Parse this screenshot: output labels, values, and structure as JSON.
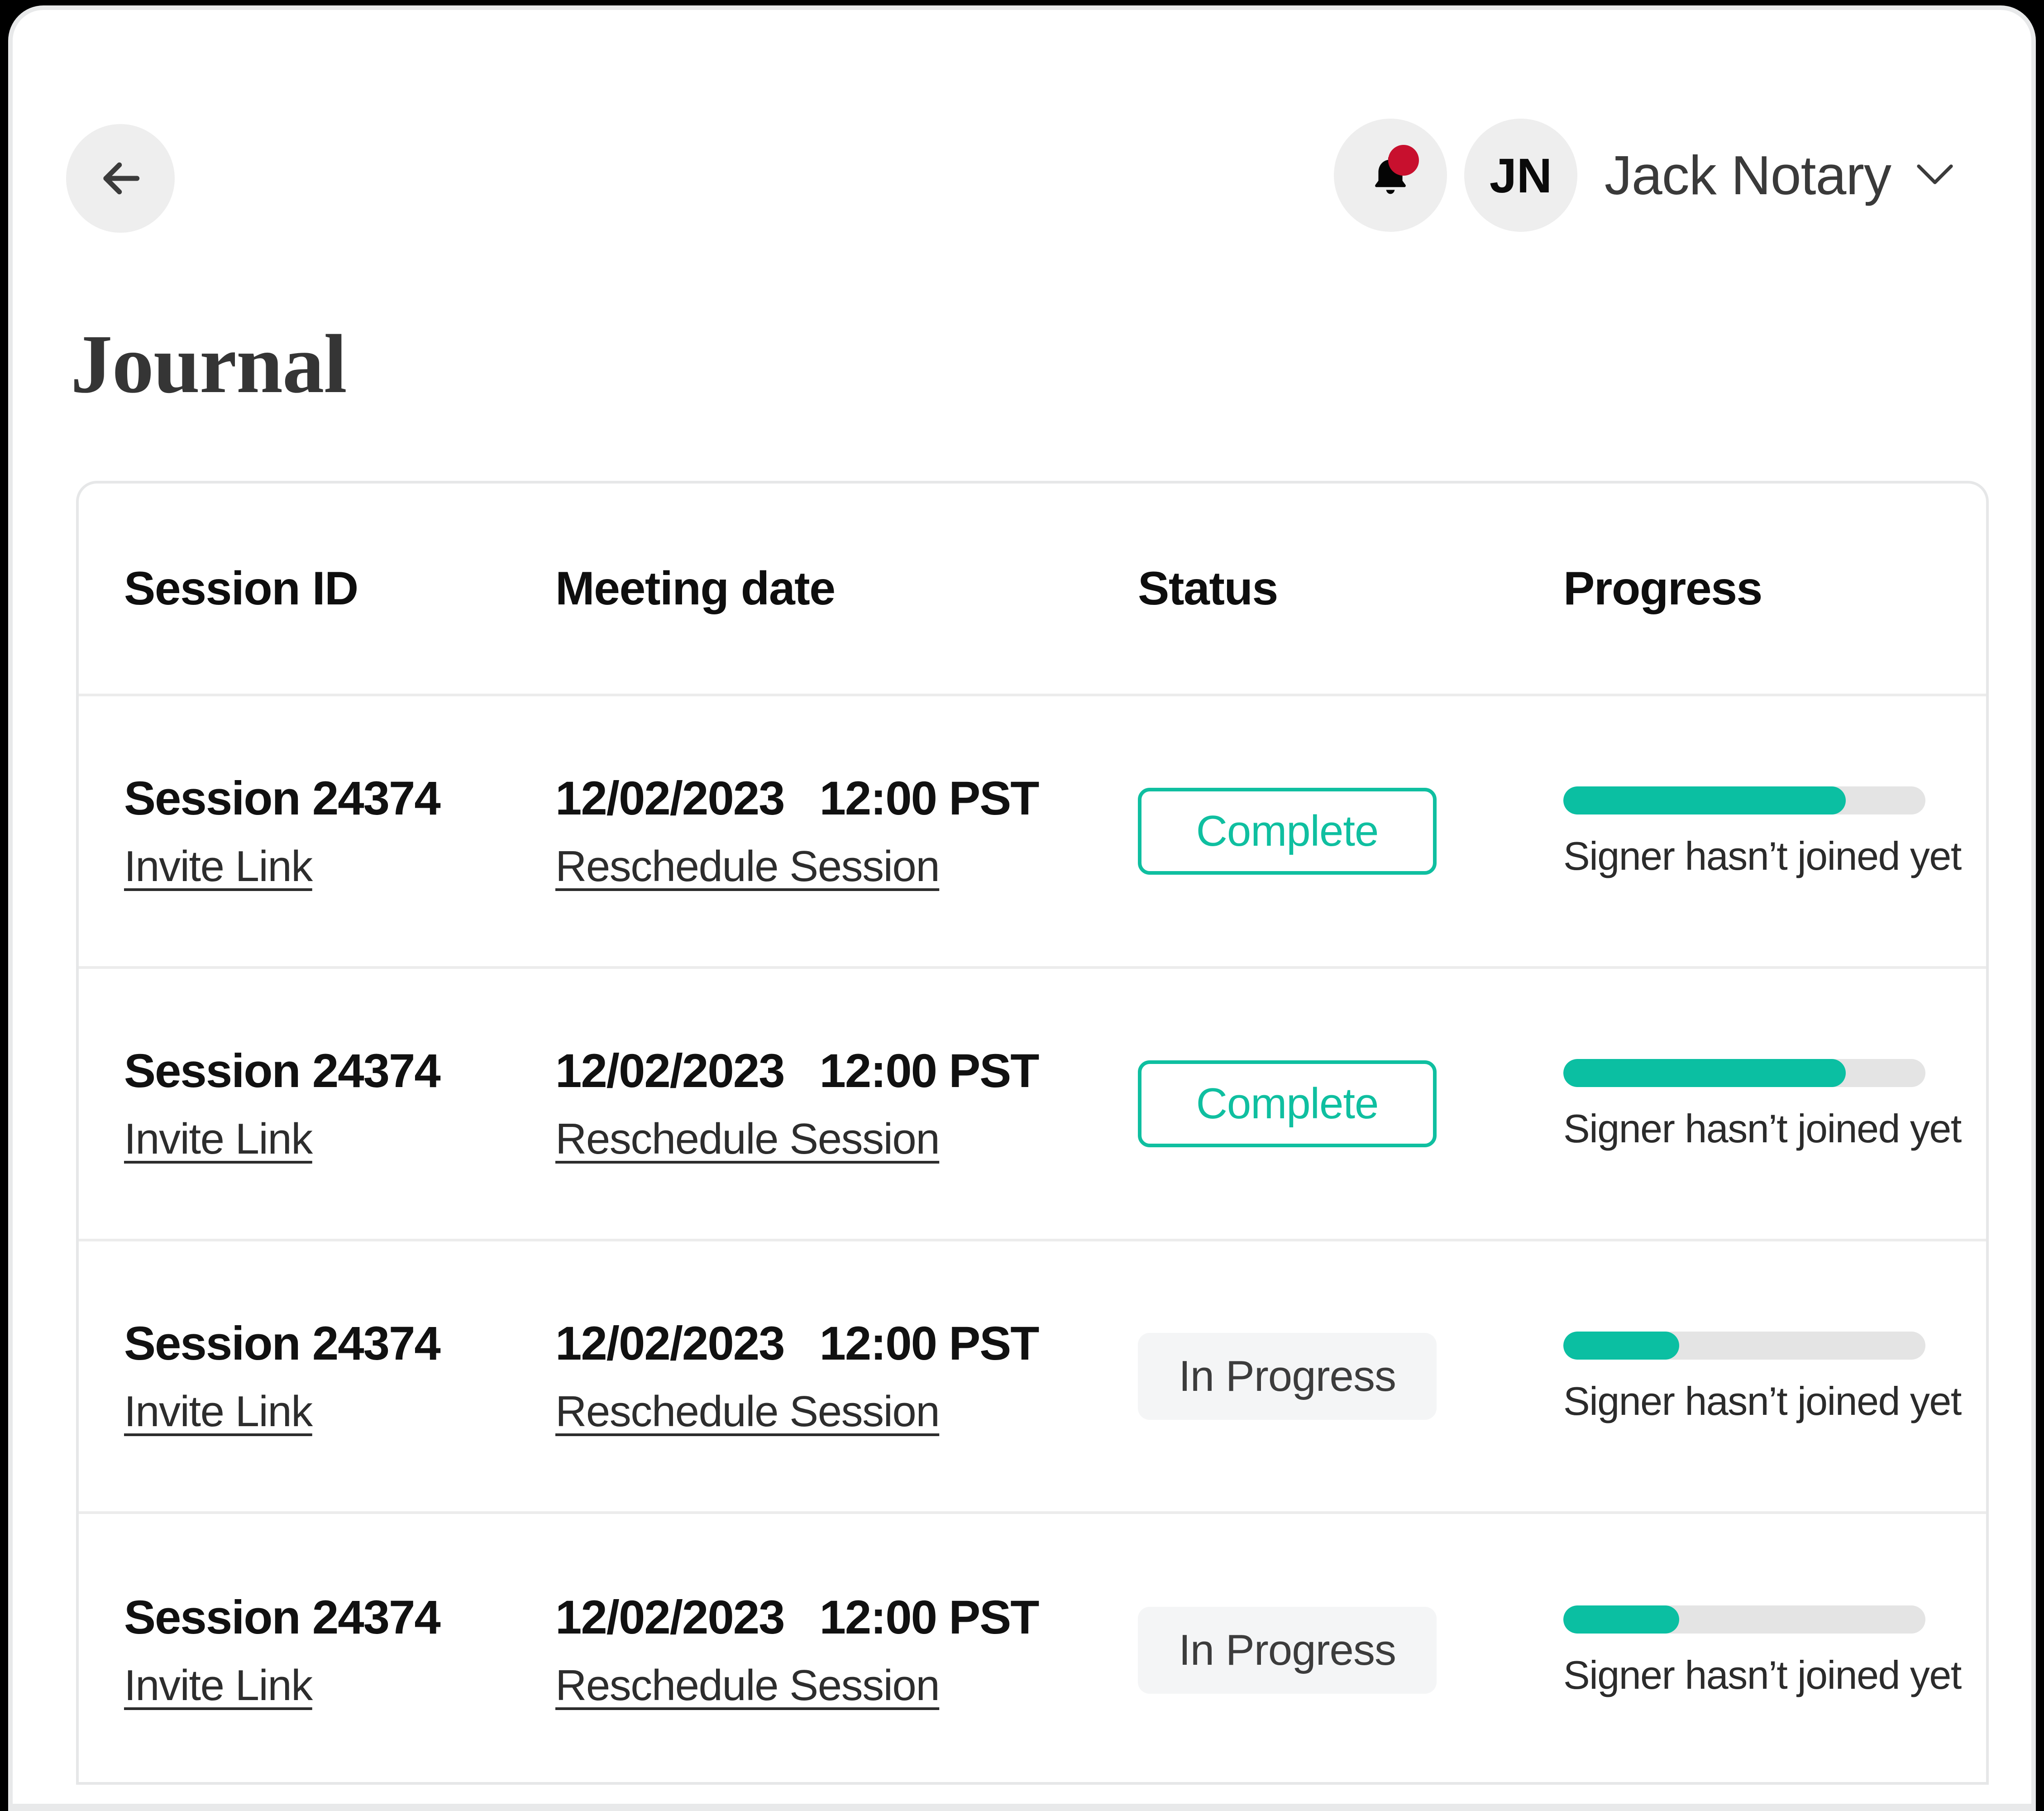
{
  "window": {
    "background_color": "#ffffff",
    "border_color": "#e8e9ea"
  },
  "topbar": {
    "back_button_label": "",
    "back_icon": "arrow-left-icon",
    "notifications": {
      "icon": "bell-icon",
      "has_unread": true,
      "badge_color": "#c8102e"
    },
    "avatar_initials": "JN",
    "user_name": "Jack Notary",
    "chevron_icon": "chevron-down-icon"
  },
  "page": {
    "title": "Journal"
  },
  "table": {
    "columns": [
      "Session ID",
      "Meeting date",
      "Status",
      "Progress"
    ],
    "rows": [
      {
        "session_id": "Session 24374",
        "invite_link_label": "Invite Link",
        "meeting_date": "12/02/2023",
        "meeting_time": "12:00 PST",
        "reschedule_label": "Reschedule Session",
        "status": "Complete",
        "status_variant": "complete",
        "progress_percent": 78,
        "progress_note": "Signer hasn’t joined yet"
      },
      {
        "session_id": "Session 24374",
        "invite_link_label": "Invite Link",
        "meeting_date": "12/02/2023",
        "meeting_time": "12:00 PST",
        "reschedule_label": "Reschedule Session",
        "status": "Complete",
        "status_variant": "complete",
        "progress_percent": 78,
        "progress_note": "Signer hasn’t joined yet"
      },
      {
        "session_id": "Session 24374",
        "invite_link_label": "Invite Link",
        "meeting_date": "12/02/2023",
        "meeting_time": "12:00 PST",
        "reschedule_label": "Reschedule Session",
        "status": "In Progress",
        "status_variant": "in-progress",
        "progress_percent": 32,
        "progress_note": "Signer hasn’t joined yet"
      },
      {
        "session_id": "Session 24374",
        "invite_link_label": "Invite Link",
        "meeting_date": "12/02/2023",
        "meeting_time": "12:00 PST",
        "reschedule_label": "Reschedule Session",
        "status": "In Progress",
        "status_variant": "in-progress",
        "progress_percent": 32,
        "progress_note": "Signer hasn’t joined yet"
      }
    ]
  },
  "colors": {
    "accent_teal": "#0bbfa2",
    "badge_outline_teal": "#0fbfa0",
    "notification_red": "#c8102e",
    "neutral_track": "#e4e4e4",
    "neutral_chip": "#f4f5f6",
    "divider": "#ececec"
  }
}
